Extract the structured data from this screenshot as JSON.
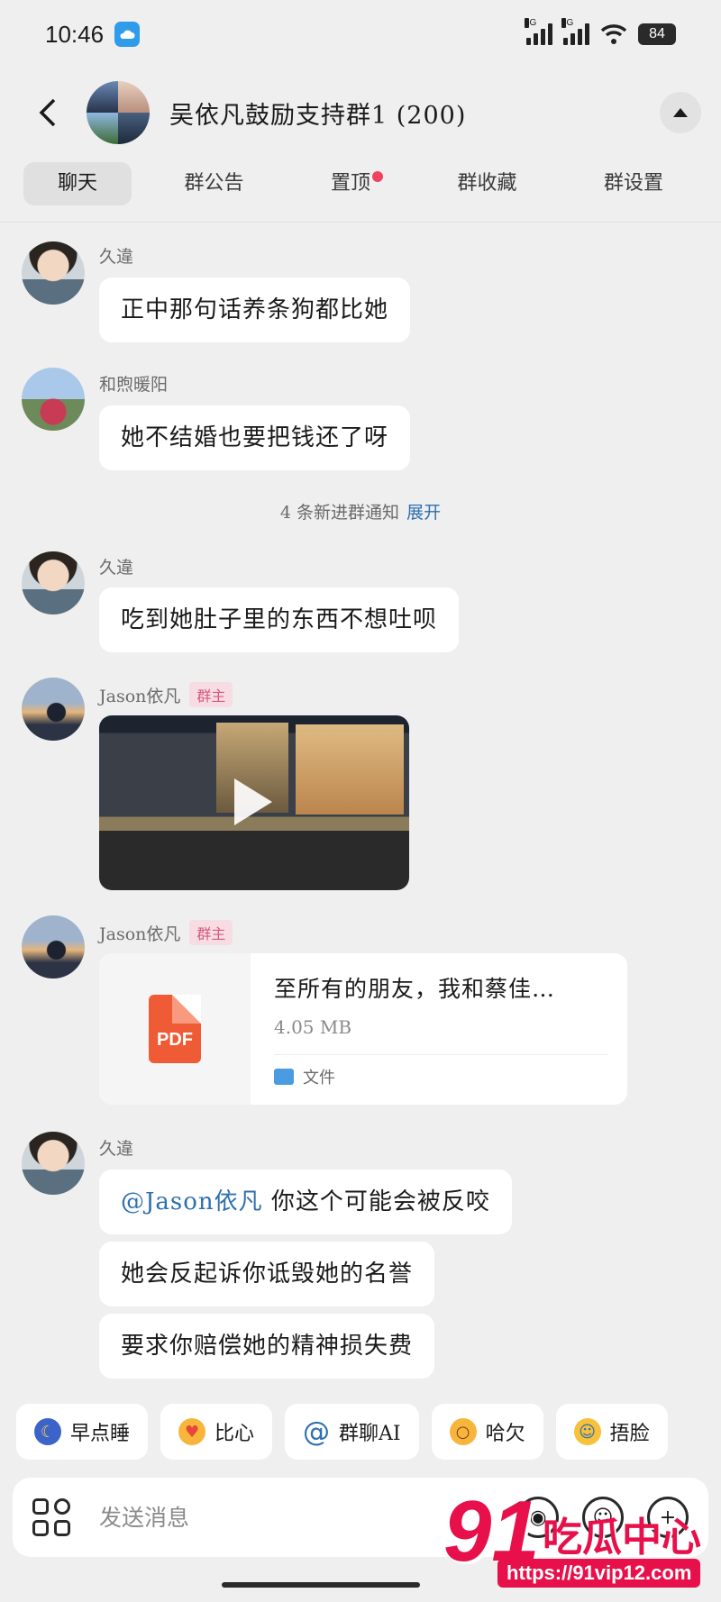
{
  "status_bar": {
    "time": "10:46",
    "network_1": "5G",
    "network_2": "5G",
    "battery": "84"
  },
  "header": {
    "title": "吴依凡鼓励支持群1 (200)"
  },
  "tabs": [
    {
      "label": "聊天",
      "active": true
    },
    {
      "label": "群公告"
    },
    {
      "label": "置顶",
      "has_dot": true
    },
    {
      "label": "群收藏"
    },
    {
      "label": "群设置"
    }
  ],
  "messages": [
    {
      "sender": "久違",
      "text": "正中那句话养条狗都比她"
    },
    {
      "sender": "和煦暖阳",
      "text": "她不结婚也要把钱还了呀"
    },
    {
      "sender": "久違",
      "text": "吃到她肚子里的东西不想吐呗"
    },
    {
      "sender": "Jason依凡",
      "badge": "群主",
      "type": "video"
    },
    {
      "sender": "Jason依凡",
      "badge": "群主",
      "type": "file",
      "file": {
        "name": "至所有的朋友，我和蔡佳…",
        "size": "4.05 MB",
        "kind": "文件",
        "thumb_label": "PDF"
      }
    },
    {
      "sender": "久違",
      "mention": "@Jason依凡",
      "text_after_mention": " 你这个可能会被反咬",
      "follow_1": "她会反起诉你诋毁她的名誉",
      "follow_2": "要求你赔偿她的精神损失费"
    }
  ],
  "notice": {
    "text": "4 条新进群通知",
    "action": "展开"
  },
  "quick_replies": [
    {
      "icon": "sleep-emoji",
      "label": "早点睡"
    },
    {
      "icon": "heart-emoji",
      "label": "比心"
    },
    {
      "icon": "at-icon",
      "label": "群聊AI"
    },
    {
      "icon": "yawn-emoji",
      "label": "哈欠"
    },
    {
      "icon": "laugh-emoji",
      "label": "捂脸"
    }
  ],
  "input": {
    "placeholder": "发送消息"
  },
  "watermark": {
    "number": "91",
    "name": "吃瓜中心",
    "url": "https://91vip12.com"
  },
  "colors": {
    "accent": "#2d6fb0",
    "badge": "#d25a7a",
    "watermark": "#e8104a"
  }
}
